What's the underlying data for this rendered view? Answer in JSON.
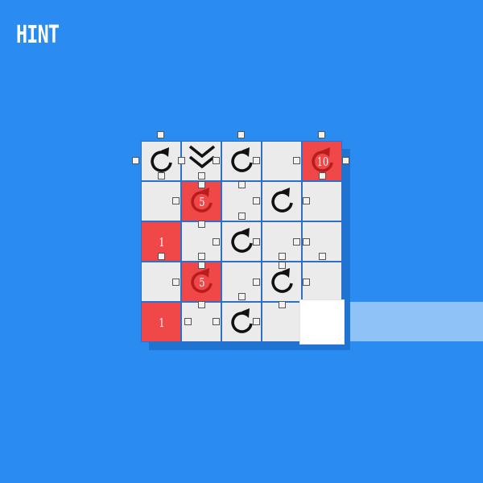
{
  "hint": {
    "label": "HINT"
  },
  "grid": {
    "rows": [
      [
        {
          "type": "rotate"
        },
        {
          "type": "double-chevron"
        },
        {
          "type": "rotate"
        },
        {
          "type": "blank"
        },
        {
          "type": "locked-rotate",
          "count": "10"
        }
      ],
      [
        {
          "type": "blank"
        },
        {
          "type": "locked-rotate",
          "count": "5"
        },
        {
          "type": "blank"
        },
        {
          "type": "rotate"
        },
        {
          "type": "blank"
        }
      ],
      [
        {
          "type": "locked",
          "count": "1"
        },
        {
          "type": "blank"
        },
        {
          "type": "rotate"
        },
        {
          "type": "blank"
        },
        {
          "type": "blank"
        }
      ],
      [
        {
          "type": "blank"
        },
        {
          "type": "locked-rotate",
          "count": "5"
        },
        {
          "type": "blank"
        },
        {
          "type": "rotate"
        },
        {
          "type": "blank"
        }
      ],
      [
        {
          "type": "locked",
          "count": "1"
        },
        {
          "type": "blank"
        },
        {
          "type": "rotate"
        },
        {
          "type": "blank"
        },
        {
          "type": "empty"
        }
      ]
    ]
  },
  "colors": {
    "background": "#2a8cf0",
    "tile": "#ebebeb",
    "locked_tile": "#f04848",
    "track": "#8fc2f7"
  },
  "icons": {
    "rotate": "rotate-clockwise-icon",
    "double_chevron": "double-chevron-down-icon"
  }
}
